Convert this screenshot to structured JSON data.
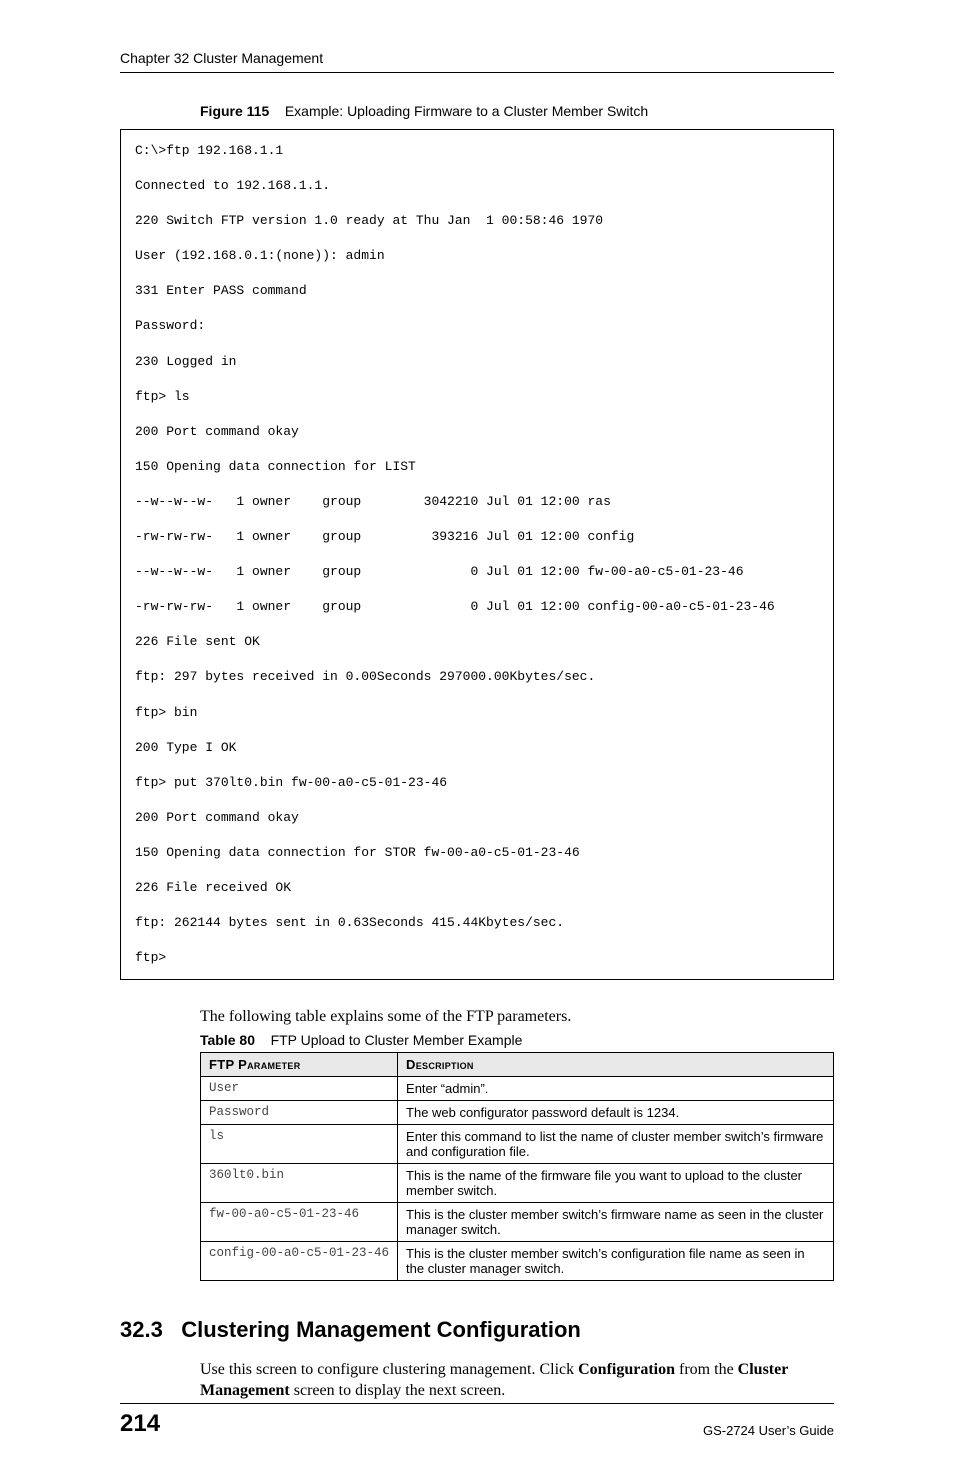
{
  "header": {
    "running": "Chapter 32 Cluster Management"
  },
  "figure": {
    "label": "Figure 115",
    "title": "Example: Uploading Firmware to a Cluster Member Switch"
  },
  "code_lines": [
    "C:\\>ftp 192.168.1.1",
    "Connected to 192.168.1.1.",
    "220 Switch FTP version 1.0 ready at Thu Jan  1 00:58:46 1970",
    "User (192.168.0.1:(none)): admin",
    "331 Enter PASS command",
    "Password:",
    "230 Logged in",
    "ftp> ls",
    "200 Port command okay",
    "150 Opening data connection for LIST",
    "--w--w--w-   1 owner    group        3042210 Jul 01 12:00 ras",
    "-rw-rw-rw-   1 owner    group         393216 Jul 01 12:00 config",
    "--w--w--w-   1 owner    group              0 Jul 01 12:00 fw-00-a0-c5-01-23-46",
    "-rw-rw-rw-   1 owner    group              0 Jul 01 12:00 config-00-a0-c5-01-23-46",
    "226 File sent OK",
    "ftp: 297 bytes received in 0.00Seconds 297000.00Kbytes/sec.",
    "ftp> bin",
    "200 Type I OK",
    "ftp> put 370lt0.bin fw-00-a0-c5-01-23-46",
    "200 Port command okay",
    "150 Opening data connection for STOR fw-00-a0-c5-01-23-46",
    "226 File received OK",
    "ftp: 262144 bytes sent in 0.63Seconds 415.44Kbytes/sec.",
    "ftp>"
  ],
  "para_intro": "The following table explains some of the FTP parameters.",
  "table": {
    "label": "Table 80",
    "title": "FTP Upload to Cluster Member Example",
    "head": {
      "c1": "FTP Parameter",
      "c2": "Description"
    },
    "rows": [
      {
        "param": "User",
        "desc": "Enter “admin”."
      },
      {
        "param": "Password",
        "desc": "The web configurator password default is 1234."
      },
      {
        "param": "ls",
        "desc": "Enter this command to list the name of cluster member switch’s firmware and configuration file."
      },
      {
        "param": "360lt0.bin",
        "desc": "This is the name of the firmware file you want to upload to the cluster member switch."
      },
      {
        "param": "fw-00-a0-c5-01-23-46",
        "desc": "This is the cluster member switch’s firmware name as seen in the cluster manager switch."
      },
      {
        "param": "config-00-a0-c5-01-23-46",
        "desc": "This is the cluster member switch’s configuration file name as seen in the cluster manager switch."
      }
    ]
  },
  "section": {
    "number": "32.3",
    "title": "Clustering Management Configuration",
    "body_parts": {
      "p1a": "Use this screen to configure clustering management. Click ",
      "p1b": "Configuration",
      "p1c": " from the ",
      "p1d": "Cluster Management",
      "p1e": " screen to display the next screen."
    }
  },
  "footer": {
    "page": "214",
    "guide": "GS-2724 User’s Guide"
  }
}
